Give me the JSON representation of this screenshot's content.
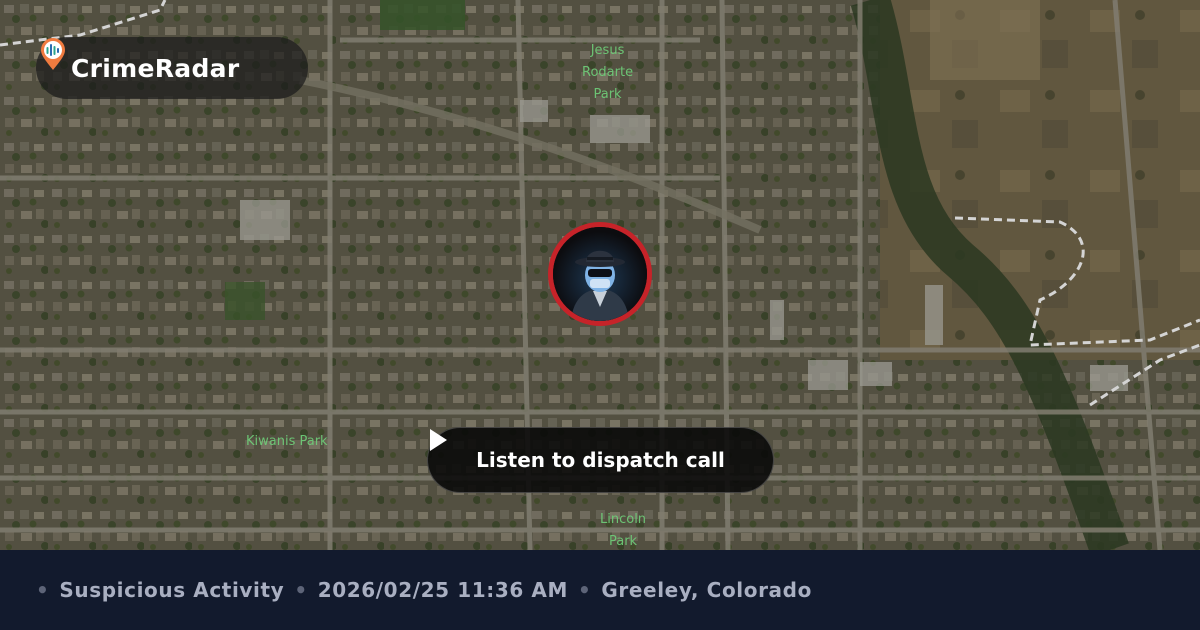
{
  "brand": {
    "name": "CrimeRadar",
    "icon": "radar-pin-icon"
  },
  "map": {
    "type": "satellite",
    "labels": {
      "jesus_rodarte_park": "Jesus\nRodarte\nPark",
      "kiwanis_park": "Kiwanis Park",
      "lincoln_park": "Lincoln\nPark"
    },
    "marker": {
      "icon": "masked-spy-icon",
      "ring_color": "#c62329"
    }
  },
  "listen_button": {
    "label": "Listen to dispatch call",
    "icon": "play-icon"
  },
  "footer": {
    "separator": "•",
    "category": "Suspicious Activity",
    "datetime": "2026/02/25 11:36 AM",
    "location": "Greeley, Colorado"
  }
}
